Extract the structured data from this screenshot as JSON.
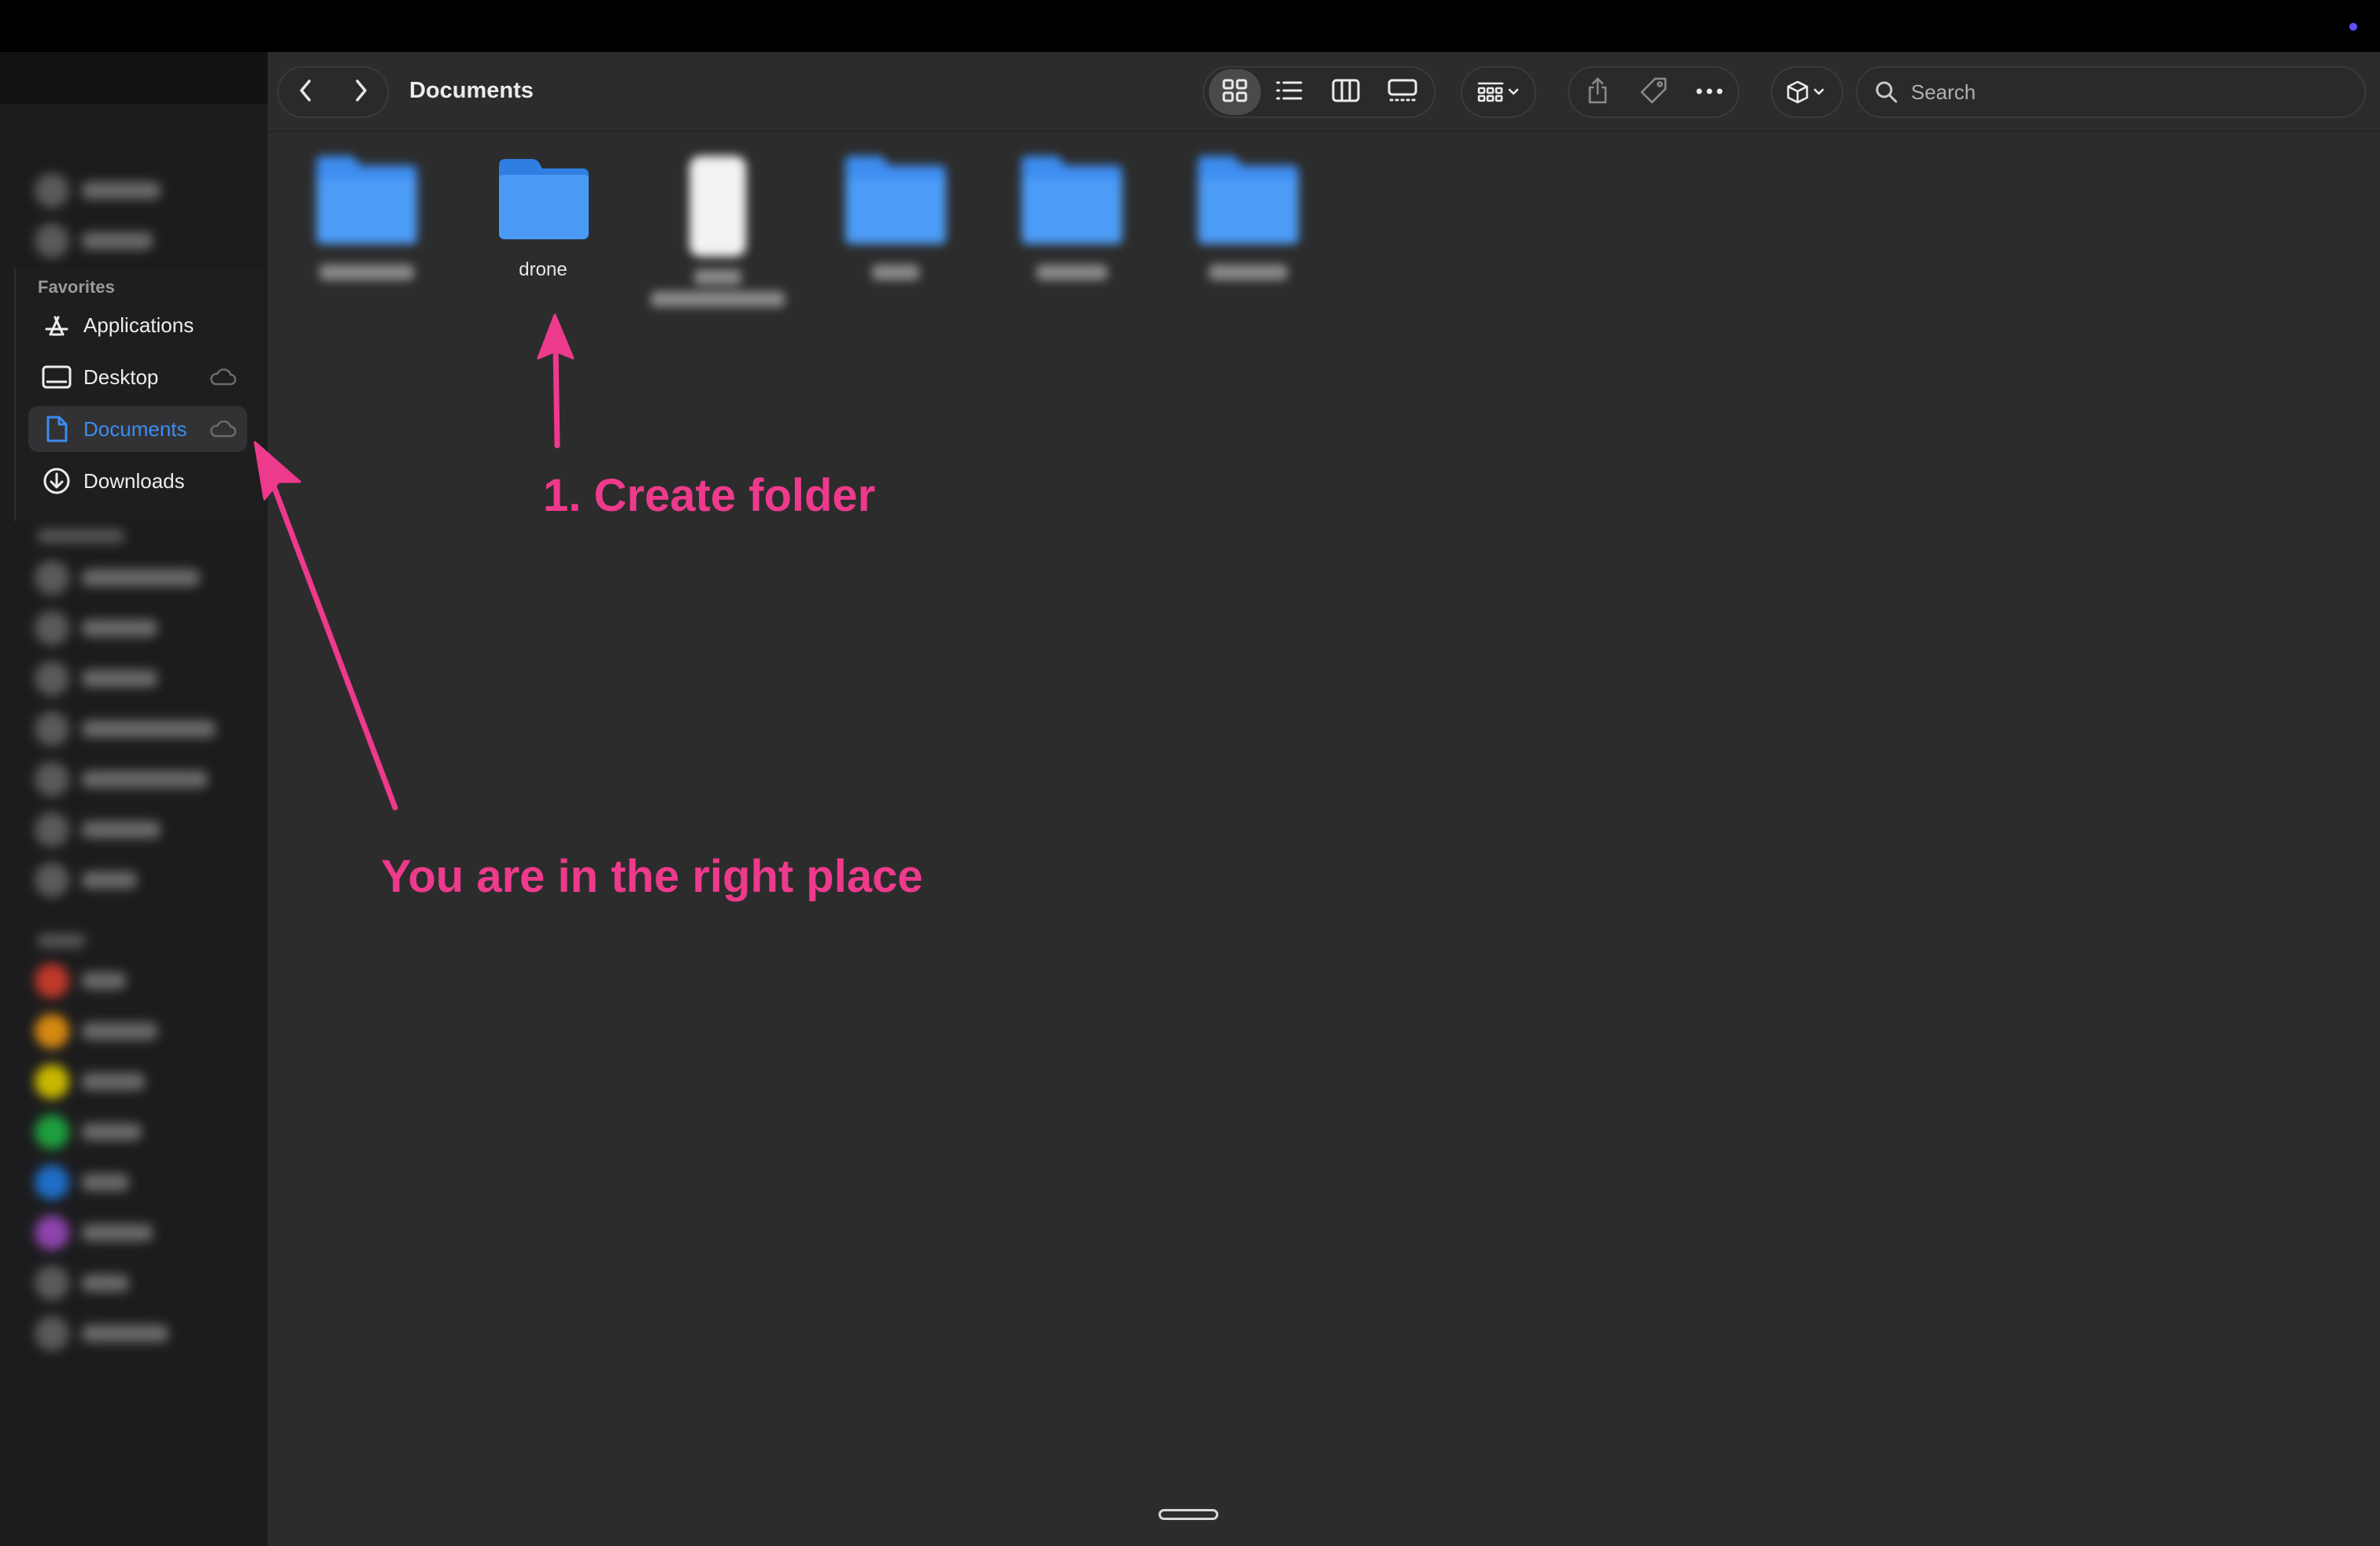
{
  "window": {
    "title": "Documents"
  },
  "sidebar": {
    "favorites_heading": "Favorites",
    "favorites": [
      {
        "label": "Applications",
        "icon": "applications-icon",
        "active": false
      },
      {
        "label": "Desktop",
        "icon": "desktop-icon",
        "active": false,
        "cloud": true
      },
      {
        "label": "Documents",
        "icon": "document-icon",
        "active": true,
        "cloud": true
      },
      {
        "label": "Downloads",
        "icon": "downloads-icon",
        "active": false
      }
    ]
  },
  "toolbar": {
    "back_icon": "chevron-left-icon",
    "forward_icon": "chevron-right-icon",
    "view_modes": [
      "icon-view",
      "list-view",
      "column-view",
      "gallery-view"
    ],
    "selected_view": "icon-view",
    "group_icon": "group-by-icon",
    "share_icon": "share-icon",
    "tag_icon": "tag-icon",
    "more_icon": "more-icon",
    "action_icon": "action-menu-icon"
  },
  "search": {
    "placeholder": "Search"
  },
  "files": [
    {
      "name": "drone",
      "type": "folder"
    }
  ],
  "annotations": {
    "step1": "1. Create folder",
    "location_hint": "You are in the right place"
  },
  "colors": {
    "accent": "#3c8cf0",
    "annotation": "#ee3a8c",
    "folder": "#4a9af5",
    "background": "#2c2c2c",
    "sidebar": "#1c1c1e"
  }
}
